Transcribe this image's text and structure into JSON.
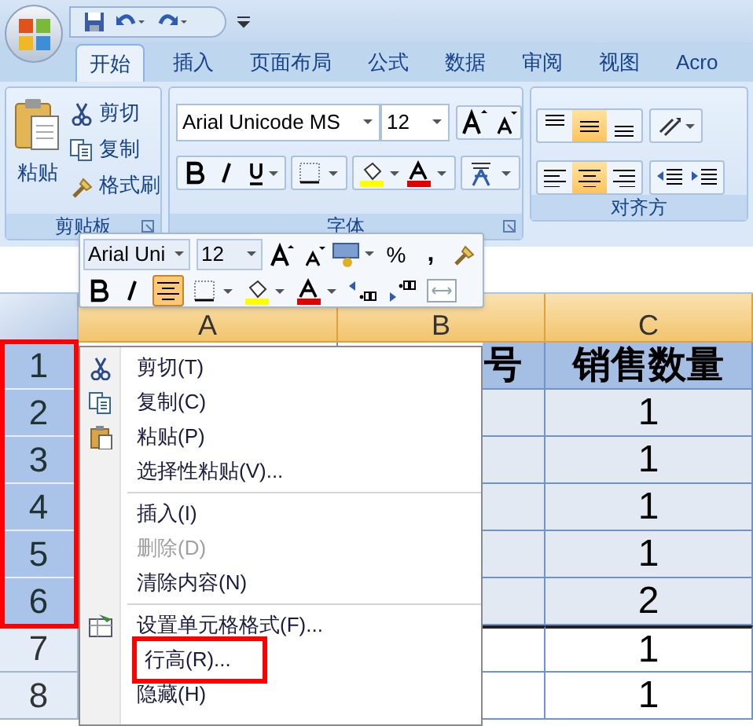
{
  "tabs": [
    {
      "label": "开始",
      "selected": true
    },
    {
      "label": "插入",
      "selected": false
    },
    {
      "label": "页面布局",
      "selected": false
    },
    {
      "label": "公式",
      "selected": false
    },
    {
      "label": "数据",
      "selected": false
    },
    {
      "label": "审阅",
      "selected": false
    },
    {
      "label": "视图",
      "selected": false
    },
    {
      "label": "Acro",
      "selected": false
    }
  ],
  "ribbon": {
    "clipboard": {
      "label": "剪贴板",
      "paste": "粘贴",
      "cut": "剪切",
      "copy": "复制",
      "format_painter": "格式刷"
    },
    "font": {
      "label": "字体",
      "font_name": "Arial Unicode MS",
      "font_size": "12"
    },
    "alignment": {
      "label": "对齐方",
      "vertical": [
        {
          "kind": "top",
          "selected": false
        },
        {
          "kind": "middle",
          "selected": true
        },
        {
          "kind": "bottom",
          "selected": false
        }
      ],
      "horizontal": [
        {
          "kind": "left",
          "selected": false
        },
        {
          "kind": "center",
          "selected": true
        },
        {
          "kind": "right",
          "selected": false
        }
      ]
    }
  },
  "mini_toolbar": {
    "font_name": "Arial Uni",
    "font_size": "12",
    "percent": "%",
    "comma": ",",
    "center_selected": true
  },
  "sheet": {
    "columns": [
      "A",
      "B",
      "C"
    ],
    "row_headers_outlined": true,
    "rows": [
      {
        "header": "1",
        "selected": true,
        "cells": [
          "号",
          "销售数量"
        ]
      },
      {
        "header": "2",
        "selected": true,
        "cells": [
          "",
          "1"
        ]
      },
      {
        "header": "3",
        "selected": true,
        "cells": [
          "",
          "1"
        ]
      },
      {
        "header": "4",
        "selected": true,
        "cells": [
          "",
          "1"
        ]
      },
      {
        "header": "5",
        "selected": true,
        "cells": [
          "",
          "1"
        ]
      },
      {
        "header": "6",
        "selected": true,
        "cells": [
          "",
          "2"
        ]
      },
      {
        "header": "7",
        "selected": false,
        "cells": [
          "",
          "1"
        ]
      },
      {
        "header": "8",
        "selected": false,
        "cells": [
          "",
          "1"
        ]
      }
    ]
  },
  "context_menu": [
    {
      "label": "剪切(T)",
      "kind": "cut",
      "disabled": false,
      "separator_before": false,
      "outlined": false
    },
    {
      "label": "复制(C)",
      "kind": "copy",
      "disabled": false,
      "separator_before": false,
      "outlined": false
    },
    {
      "label": "粘贴(P)",
      "kind": "paste",
      "disabled": false,
      "separator_before": false,
      "outlined": false
    },
    {
      "label": "选择性粘贴(V)...",
      "kind": "plain",
      "disabled": false,
      "separator_before": false,
      "outlined": false
    },
    {
      "label": "插入(I)",
      "kind": "plain",
      "disabled": false,
      "separator_before": true,
      "outlined": false
    },
    {
      "label": "删除(D)",
      "kind": "plain",
      "disabled": true,
      "separator_before": false,
      "outlined": false
    },
    {
      "label": "清除内容(N)",
      "kind": "plain",
      "disabled": false,
      "separator_before": false,
      "outlined": false
    },
    {
      "label": "设置单元格格式(F)...",
      "kind": "format",
      "disabled": false,
      "separator_before": true,
      "outlined": false
    },
    {
      "label": "行高(R)...",
      "kind": "plain",
      "disabled": false,
      "separator_before": false,
      "outlined": true
    },
    {
      "label": "隐藏(H)",
      "kind": "plain",
      "disabled": false,
      "separator_before": false,
      "outlined": false
    }
  ]
}
